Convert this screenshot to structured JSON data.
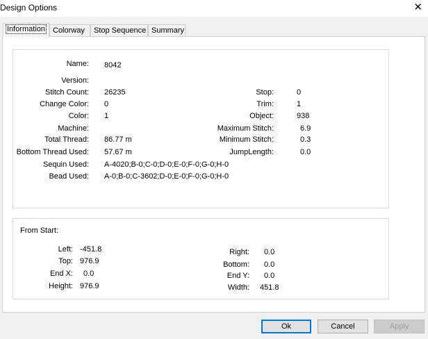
{
  "window": {
    "title": "Design Options"
  },
  "tabs": [
    "Information",
    "Colorway",
    "Stop Sequence",
    "Summary"
  ],
  "info": {
    "name_label": "Name:",
    "name_value": "8042",
    "version_label": "Version:",
    "version_value": "",
    "stitch_count_label": "Stitch Count:",
    "stitch_count_value": "26235",
    "change_color_label": "Change Color:",
    "change_color_value": "0",
    "color_label": "Color:",
    "color_value": "1",
    "machine_label": "Machine:",
    "machine_value": "",
    "total_thread_label": "Total Thread:",
    "total_thread_value": "86.77 m",
    "bottom_thread_label": "Bottom Thread Used:",
    "bottom_thread_value": "57.67 m",
    "sequin_label": "Sequin Used:",
    "sequin_value": "A-4020;B-0;C-0;D-0;E-0;F-0;G-0;H-0",
    "bead_label": "Bead Used:",
    "bead_value": "A-0;B-0;C-3602;D-0;E-0;F-0;G-0;H-0",
    "stop_label": "Stop:",
    "stop_value": "0",
    "trim_label": "Trim:",
    "trim_value": "1",
    "object_label": "Object:",
    "object_value": "938",
    "max_stitch_label": "Maximum Stitch:",
    "max_stitch_value": "6.9",
    "min_stitch_label": "Minimum Stitch:",
    "min_stitch_value": "0.3",
    "jump_length_label": "JumpLength:",
    "jump_length_value": "0.0"
  },
  "from_start": {
    "heading": "From Start:",
    "left_label": "Left:",
    "left_value": "-451.8",
    "top_label": "Top:",
    "top_value": "976.9",
    "endx_label": "End X:",
    "endx_value": "0.0",
    "height_label": "Height:",
    "height_value": "976.9",
    "right_label": "Right:",
    "right_value": "0.0",
    "bottom_label": "Bottom:",
    "bottom_value": "0.0",
    "endy_label": "End Y:",
    "endy_value": "0.0",
    "width_label": "Width:",
    "width_value": "451.8"
  },
  "buttons": {
    "ok": "Ok",
    "cancel": "Cancel",
    "apply": "Apply"
  }
}
